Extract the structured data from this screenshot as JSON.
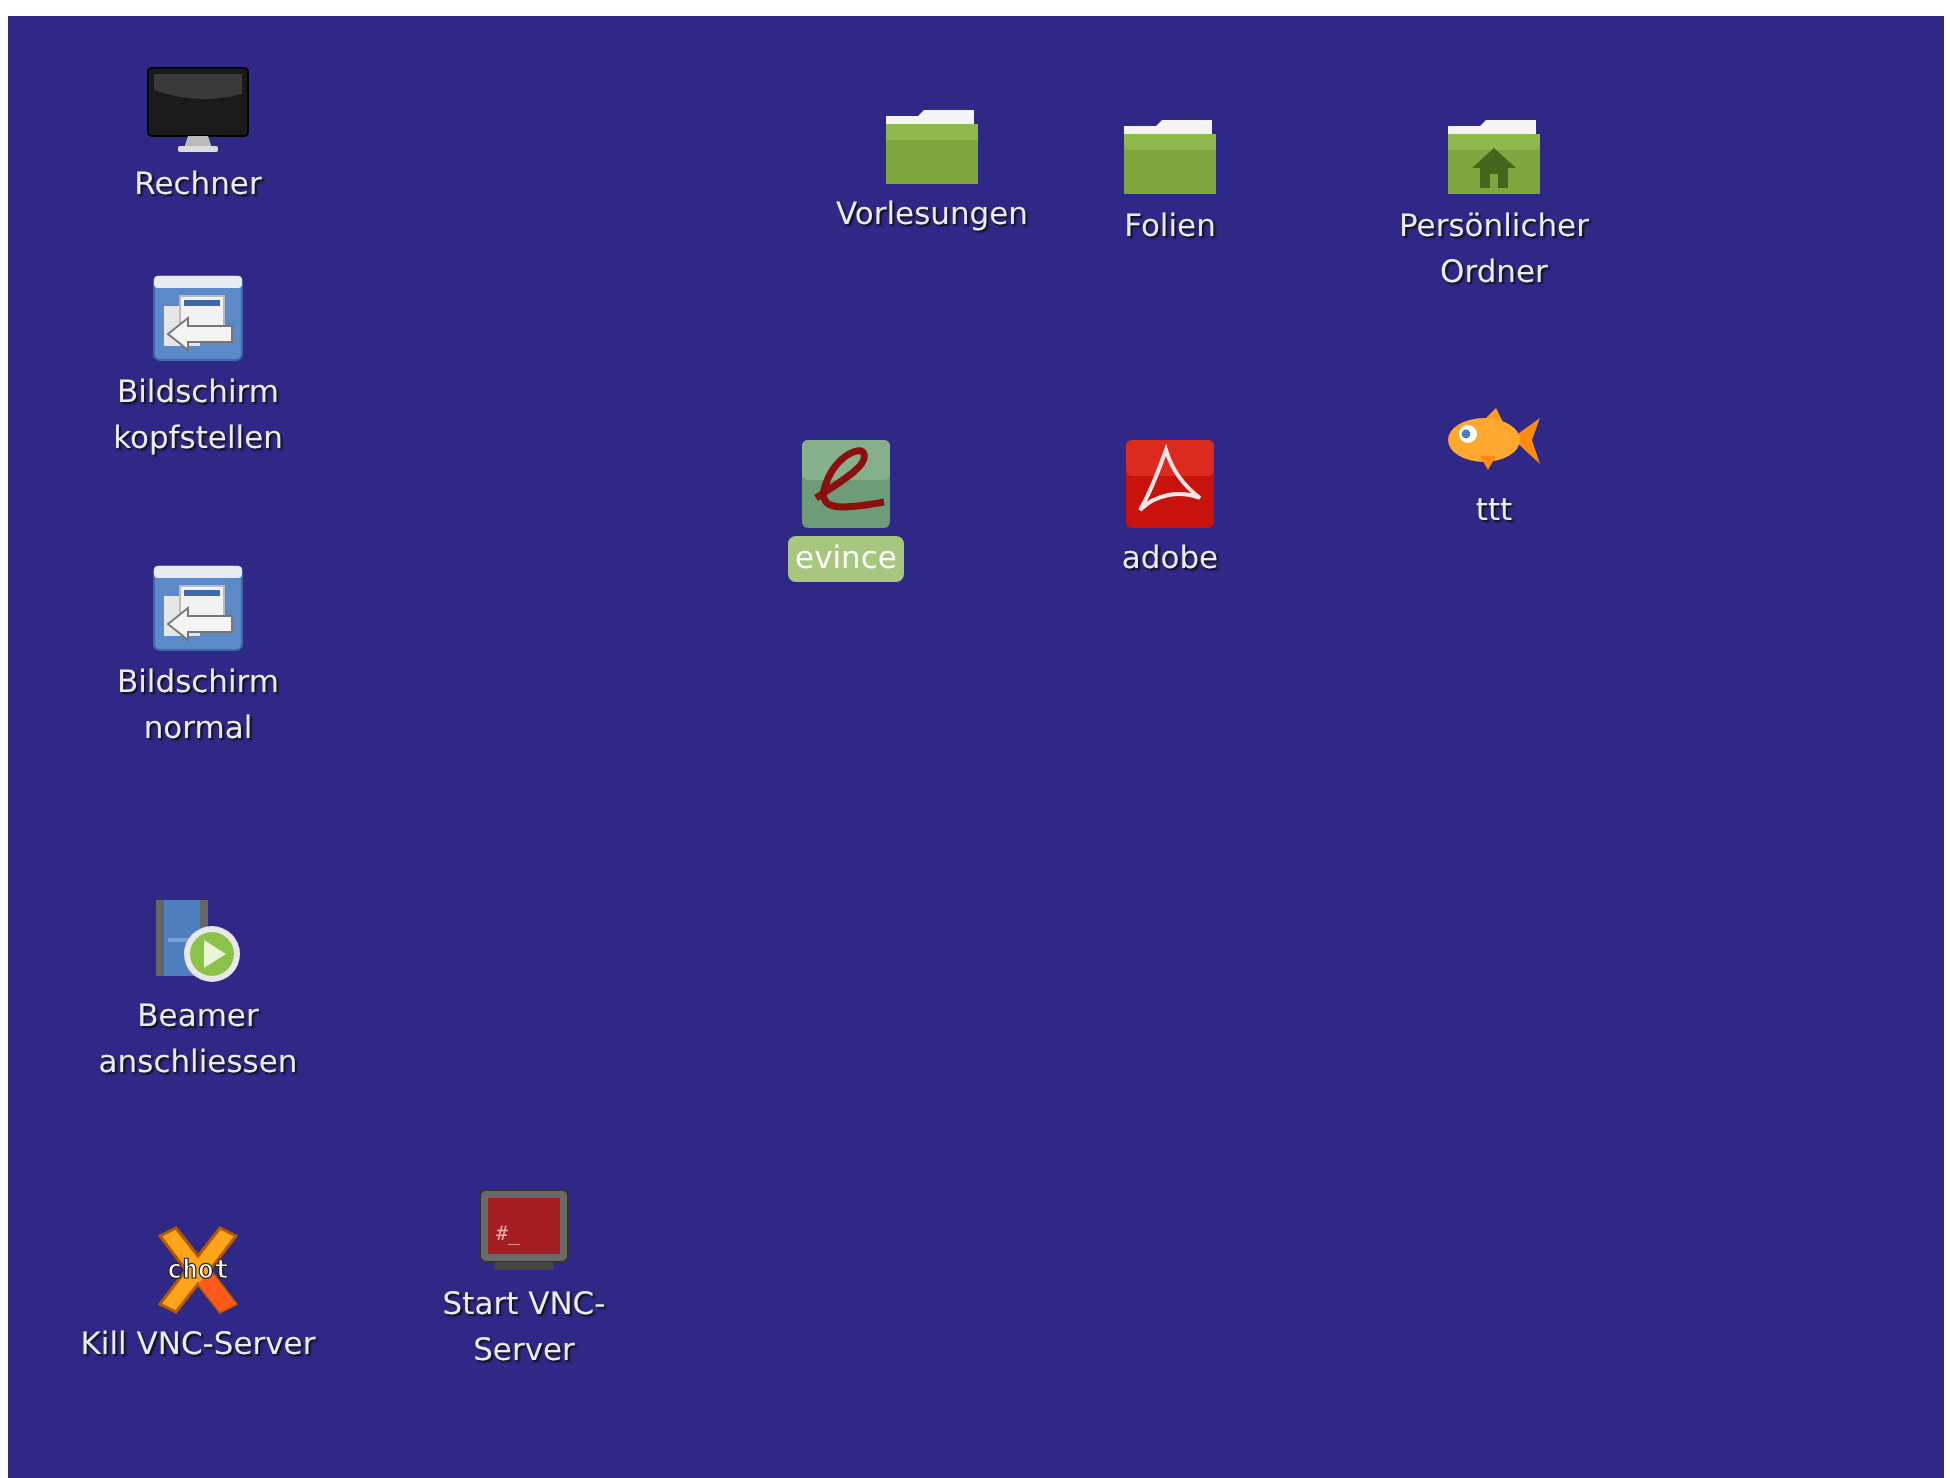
{
  "desktop": {
    "icons": [
      {
        "label": "Rechner",
        "kind": "monitor",
        "selected": false
      },
      {
        "label": "Bildschirm\nkopfstellen",
        "kind": "window-arrow",
        "selected": false
      },
      {
        "label": "Bildschirm\nnormal",
        "kind": "window-arrow",
        "selected": false
      },
      {
        "label": "Beamer\nanschliessen",
        "kind": "film",
        "selected": false
      },
      {
        "label": "Kill VNC-Server",
        "kind": "x-logo",
        "badge": "chot",
        "selected": false
      },
      {
        "label": "Start VNC-\nServer",
        "kind": "terminal",
        "badge": "#_",
        "selected": false
      },
      {
        "label": "Vorlesungen",
        "kind": "folder",
        "selected": false
      },
      {
        "label": "Folien",
        "kind": "folder",
        "selected": false
      },
      {
        "label": "Persönlicher\nOrdner",
        "kind": "home-folder",
        "selected": false
      },
      {
        "label": "evince",
        "kind": "viewer",
        "selected": true
      },
      {
        "label": "adobe",
        "kind": "pdf",
        "selected": false
      },
      {
        "label": "ttt",
        "kind": "fish",
        "selected": false
      }
    ]
  }
}
